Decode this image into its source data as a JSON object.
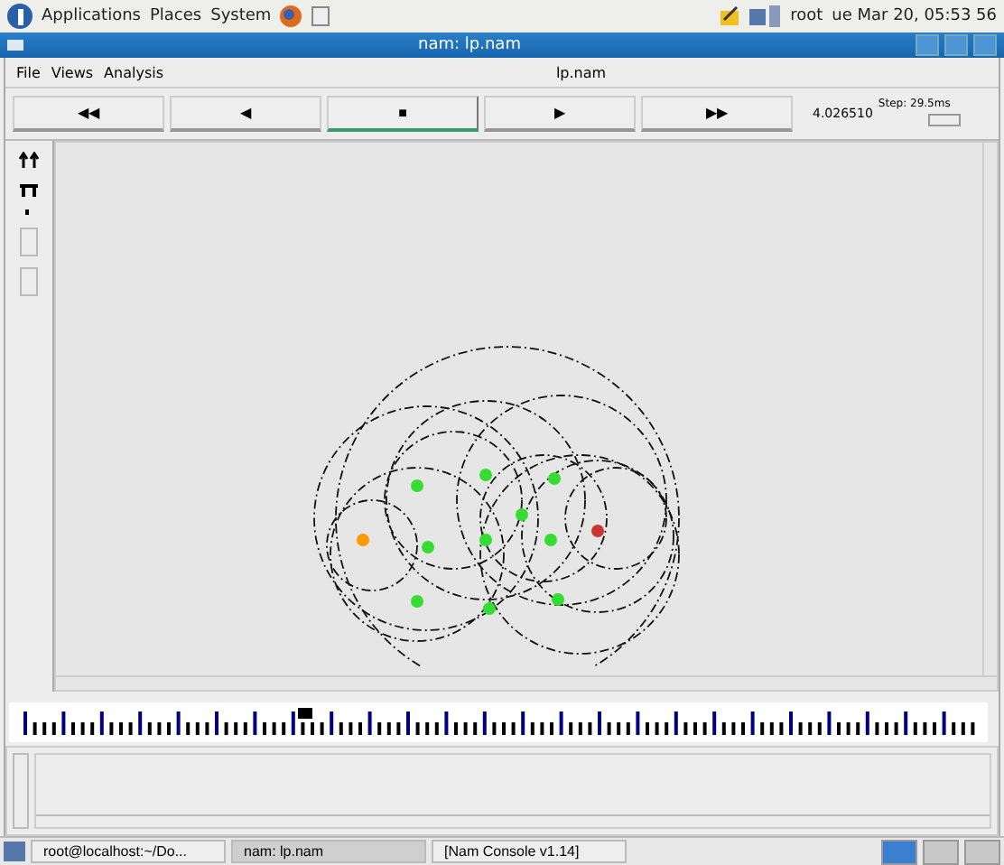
{
  "top_panel": {
    "menus": [
      "Applications",
      "Places",
      "System"
    ],
    "user": "root",
    "clock": "ue Mar 20, 05:53 56"
  },
  "window": {
    "title": "nam: lp.nam"
  },
  "menu": [
    "File",
    "Views",
    "Analysis"
  ],
  "file_label": "lp.nam",
  "controls": [
    {
      "label": "◀◀",
      "selected": false
    },
    {
      "label": "◀",
      "selected": false
    },
    {
      "label": "■",
      "selected": true
    },
    {
      "label": "▶",
      "selected": false
    },
    {
      "label": "▶▶",
      "selected": false
    }
  ],
  "time": "4.026510",
  "step": "Step: 29.5ms",
  "nodes": [
    {
      "color": "#ff9900"
    },
    {
      "color": "#33dd33"
    },
    {
      "color": "#33dd33"
    },
    {
      "color": "#33dd33"
    },
    {
      "color": "#33dd33"
    },
    {
      "color": "#33dd33"
    },
    {
      "color": "#33dd33"
    },
    {
      "color": "#33dd33"
    },
    {
      "color": "#33dd33"
    },
    {
      "color": "#33dd33"
    },
    {
      "color": "#33dd33"
    },
    {
      "color": "#cc3333"
    }
  ],
  "taskbar": [
    {
      "label": "root@localhost:~/Do...",
      "selected": false
    },
    {
      "label": "nam: lp.nam",
      "selected": true
    },
    {
      "label": "[Nam Console v1.14]",
      "selected": false
    }
  ]
}
